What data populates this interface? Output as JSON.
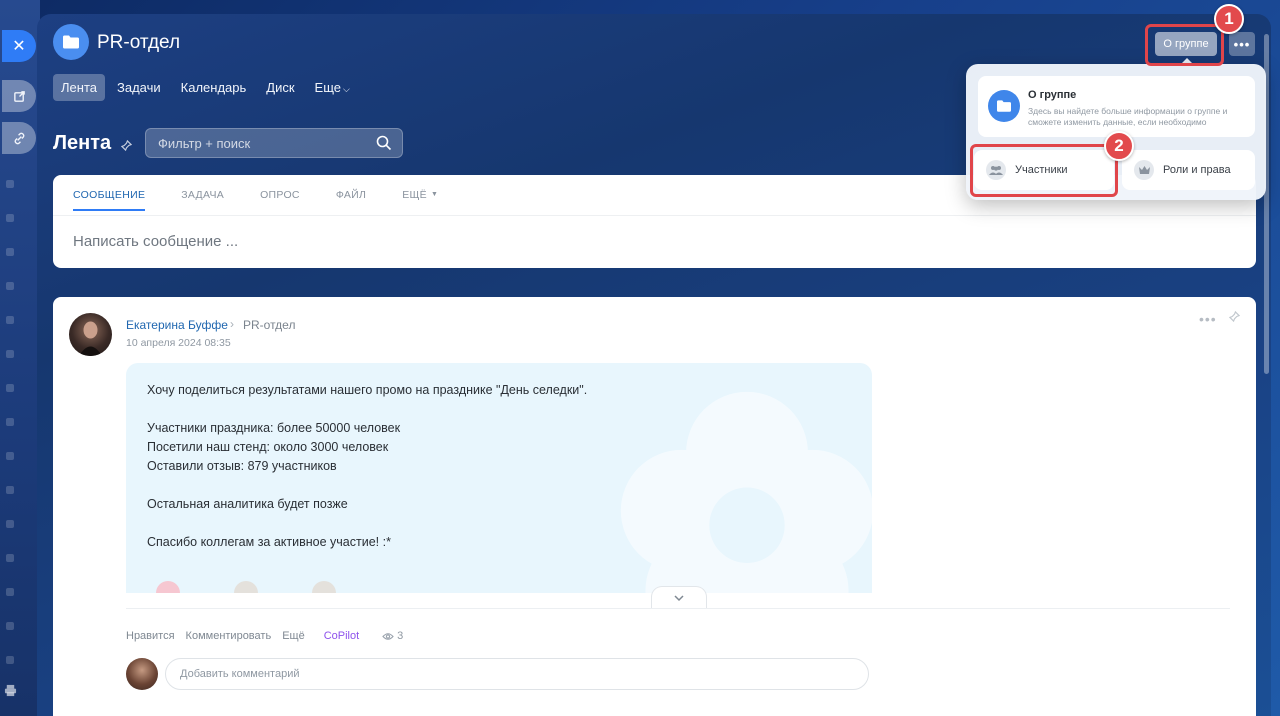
{
  "left_panel": {
    "close_icon": "✕",
    "open_new_window_icon": "external-link-icon",
    "copy_link_icon": "link-icon"
  },
  "header": {
    "group_name": "PR-отдел",
    "group_icon": "folder-icon",
    "nav": [
      {
        "label": "Лента",
        "active": true
      },
      {
        "label": "Задачи"
      },
      {
        "label": "Календарь"
      },
      {
        "label": "Диск"
      },
      {
        "label": "Еще"
      }
    ],
    "about_button": "О группе",
    "more_button": "•••"
  },
  "annotations": [
    "1",
    "2"
  ],
  "feed": {
    "title": "Лента",
    "search_placeholder": "Фильтр + поиск"
  },
  "composer": {
    "tabs": [
      {
        "label": "СООБЩЕНИЕ",
        "active": true
      },
      {
        "label": "ЗАДАЧА"
      },
      {
        "label": "ОПРОС"
      },
      {
        "label": "ФАЙЛ"
      },
      {
        "label": "ЕЩЁ"
      }
    ],
    "placeholder": "Написать сообщение ..."
  },
  "post": {
    "author": "Екатерина Буффе",
    "separator": "›",
    "group": "PR-отдел",
    "date": "10 апреля 2024 08:35",
    "lines": [
      "Хочу поделиться результатами нашего промо на празднике \"День селедки\".",
      "",
      "Участники праздника: более 50000 человек",
      "Посетили наш стенд: около 3000 человек",
      "Оставили отзыв: 879 участников",
      "",
      "Остальная аналитика будет позже",
      "",
      "Спасибо коллегам за активное участие! :*"
    ],
    "actions": {
      "like": "Нравится",
      "comment": "Комментировать",
      "more": "Ещё",
      "copilot": "CoPilot",
      "views": "3"
    },
    "comment_placeholder": "Добавить комментарий"
  },
  "popup": {
    "info_title": "О группе",
    "info_desc": "Здесь вы найдете больше информации о группе и сможете изменить данные, если необходимо",
    "members": "Участники",
    "roles": "Роли и права"
  },
  "colors": {
    "accent": "#2f7cf6",
    "annotation_red": "#e0454a",
    "copilot": "#8e52ec",
    "link": "#2067b0"
  }
}
